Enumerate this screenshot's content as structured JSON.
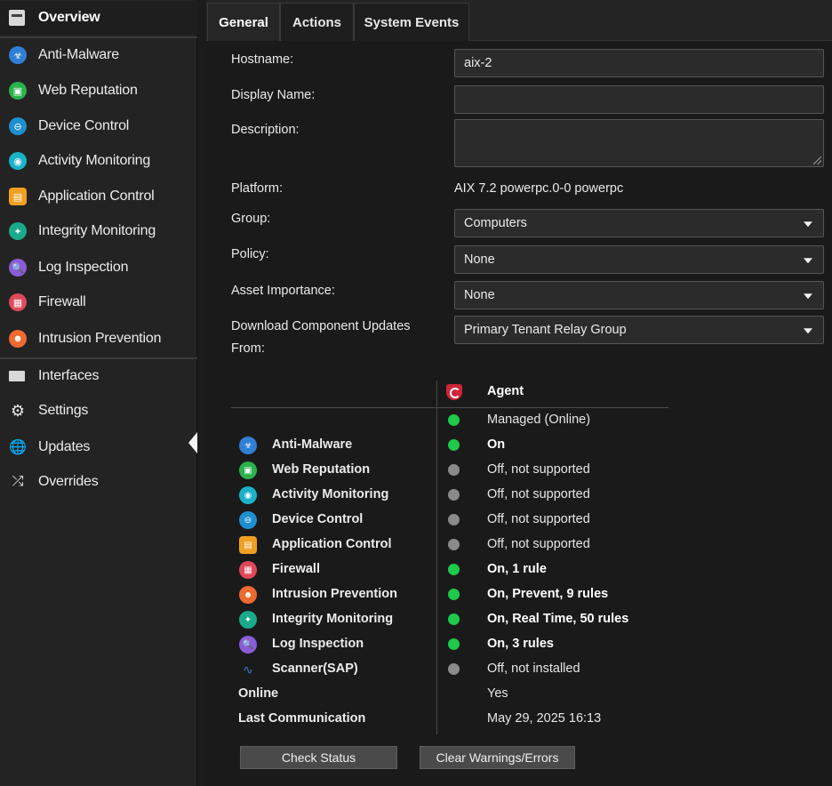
{
  "sidebar": {
    "items": [
      {
        "label": "Overview",
        "icon": "overview-icon",
        "color": "#e9e9e9"
      },
      {
        "label": "Anti-Malware",
        "icon": "anti-malware-icon",
        "color": "#2f7fd6"
      },
      {
        "label": "Web Reputation",
        "icon": "web-reputation-icon",
        "color": "#2bb24c"
      },
      {
        "label": "Device Control",
        "icon": "device-control-icon",
        "color": "#1f8fd0"
      },
      {
        "label": "Activity Monitoring",
        "icon": "activity-monitoring-icon",
        "color": "#1ab2c8"
      },
      {
        "label": "Application Control",
        "icon": "application-control-icon",
        "color": "#f0a020"
      },
      {
        "label": "Integrity Monitoring",
        "icon": "integrity-monitoring-icon",
        "color": "#1aa98a"
      },
      {
        "label": "Log Inspection",
        "icon": "log-inspection-icon",
        "color": "#8a5cd6"
      },
      {
        "label": "Firewall",
        "icon": "firewall-icon",
        "color": "#e0485a"
      },
      {
        "label": "Intrusion Prevention",
        "icon": "intrusion-prevention-icon",
        "color": "#ee6a30"
      },
      {
        "label": "Interfaces",
        "icon": "interfaces-icon",
        "color": "#d8d8d8"
      },
      {
        "label": "Settings",
        "icon": "gear-icon",
        "color": "#e8e8e8"
      },
      {
        "label": "Updates",
        "icon": "updates-icon",
        "color": "#e8e8e8"
      },
      {
        "label": "Overrides",
        "icon": "overrides-icon",
        "color": "#e8e8e8"
      }
    ]
  },
  "tabs": [
    "General",
    "Actions",
    "System Events"
  ],
  "form": {
    "hostname_label": "Hostname:",
    "hostname_value": "aix-2",
    "display_name_label": "Display Name:",
    "display_name_value": "",
    "description_label": "Description:",
    "description_value": "",
    "platform_label": "Platform:",
    "platform_value": "AIX 7.2 powerpc.0-0 powerpc",
    "group_label": "Group:",
    "group_value": "Computers",
    "policy_label": "Policy:",
    "policy_value": "None",
    "asset_label": "Asset Importance:",
    "asset_value": "None",
    "download_label_1": "Download Component Updates",
    "download_label_2": "From:",
    "download_value": "Primary Tenant Relay Group"
  },
  "status": {
    "agent_header": "Agent",
    "managed": "Managed (Online)",
    "rows": [
      {
        "name": "Anti-Malware",
        "status": "On",
        "dot": "green",
        "icon": "anti-malware-icon",
        "color": "#2f7fd6"
      },
      {
        "name": "Web Reputation",
        "status": "Off, not supported",
        "dot": "gray",
        "icon": "web-reputation-icon",
        "color": "#2bb24c"
      },
      {
        "name": "Activity Monitoring",
        "status": "Off, not supported",
        "dot": "gray",
        "icon": "activity-monitoring-icon",
        "color": "#1ab2c8"
      },
      {
        "name": "Device Control",
        "status": "Off, not supported",
        "dot": "gray",
        "icon": "device-control-icon",
        "color": "#1f8fd0"
      },
      {
        "name": "Application Control",
        "status": "Off, not supported",
        "dot": "gray",
        "icon": "application-control-icon",
        "color": "#f0a020"
      },
      {
        "name": "Firewall",
        "status": "On, 1 rule",
        "dot": "green",
        "icon": "firewall-icon",
        "color": "#e0485a"
      },
      {
        "name": "Intrusion Prevention",
        "status": "On, Prevent, 9 rules",
        "dot": "green",
        "icon": "intrusion-prevention-icon",
        "color": "#ee6a30"
      },
      {
        "name": "Integrity Monitoring",
        "status": "On, Real Time, 50 rules",
        "dot": "green",
        "icon": "integrity-monitoring-icon",
        "color": "#1aa98a"
      },
      {
        "name": "Log Inspection",
        "status": "On, 3 rules",
        "dot": "green",
        "icon": "log-inspection-icon",
        "color": "#8a5cd6"
      },
      {
        "name": "Scanner(SAP)",
        "status": "Off, not installed",
        "dot": "gray",
        "icon": "scanner-icon",
        "color": "#3a7ad0"
      }
    ],
    "online_label": "Online",
    "online_value": "Yes",
    "last_comm_label": "Last Communication",
    "last_comm_value": "May 29, 2025 16:13"
  },
  "buttons": {
    "check_status": "Check Status",
    "clear_warnings": "Clear Warnings/Errors"
  }
}
